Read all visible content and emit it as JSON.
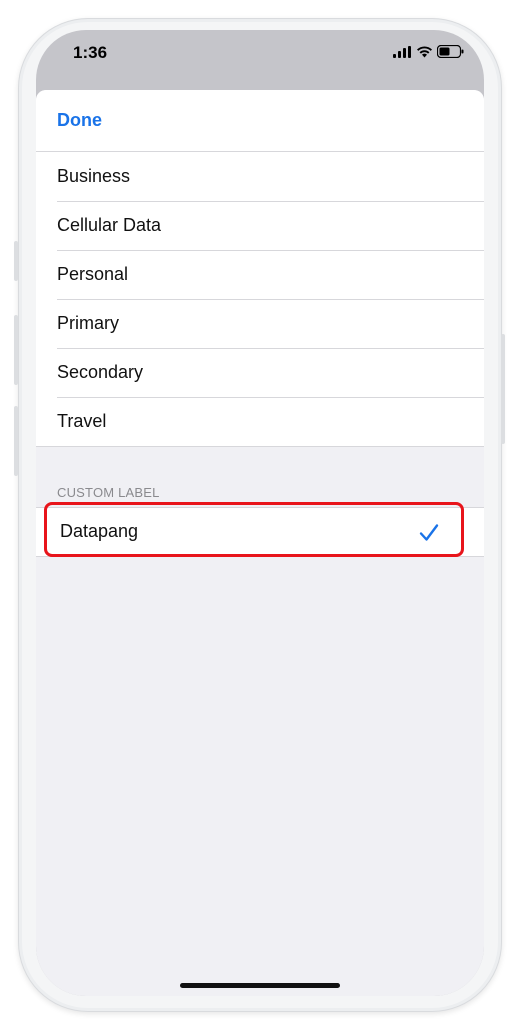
{
  "status_bar": {
    "time": "1:36",
    "icons": [
      "cellular-signal-icon",
      "wifi-icon",
      "battery-icon"
    ]
  },
  "nav": {
    "done_label": "Done"
  },
  "label_options": [
    {
      "label": "Business"
    },
    {
      "label": "Cellular Data"
    },
    {
      "label": "Personal"
    },
    {
      "label": "Primary"
    },
    {
      "label": "Secondary"
    },
    {
      "label": "Travel"
    }
  ],
  "custom_section": {
    "header": "CUSTOM LABEL",
    "value": "Datapang",
    "selected": true,
    "checkmark_icon": "checkmark-icon"
  },
  "colors": {
    "accent": "#1a73e8",
    "highlight": "#e8141b",
    "background": "#f0f0f4"
  }
}
